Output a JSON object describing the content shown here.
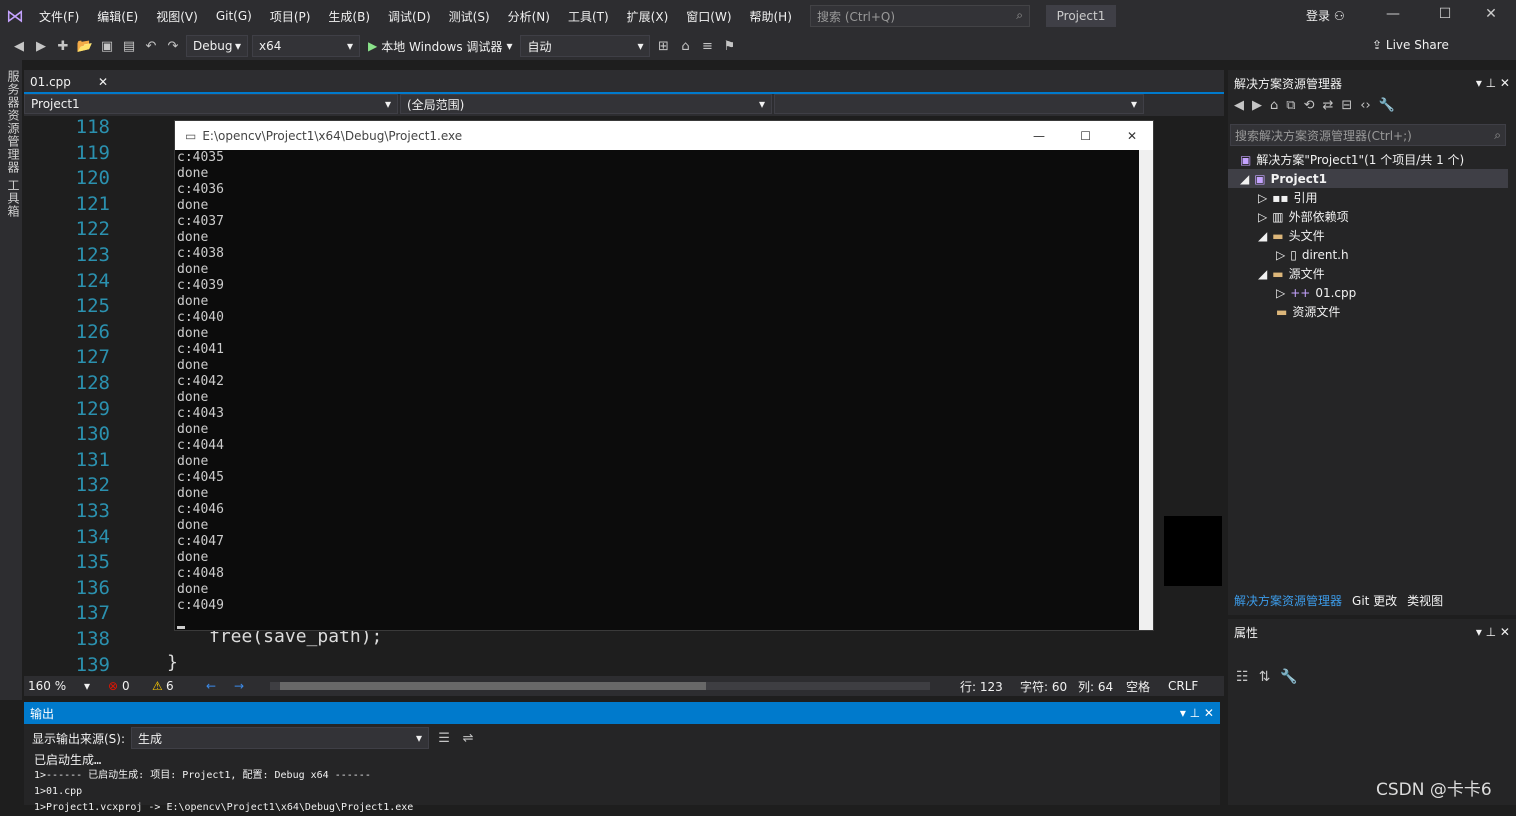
{
  "menubar": {
    "items": [
      "文件(F)",
      "编辑(E)",
      "视图(V)",
      "Git(G)",
      "项目(P)",
      "生成(B)",
      "调试(D)",
      "测试(S)",
      "分析(N)",
      "工具(T)",
      "扩展(X)",
      "窗口(W)",
      "帮助(H)"
    ],
    "search_placeholder": "搜索 (Ctrl+Q)",
    "project_title": "Project1",
    "login": "登录"
  },
  "toolbar": {
    "config": "Debug",
    "platform": "x64",
    "run_label": "本地 Windows 调试器",
    "mode": "自动",
    "live_share": "Live Share"
  },
  "sidebar_vertical": "服务器资源管理器  工具箱",
  "editor": {
    "tab": "01.cpp",
    "nav_project": "Project1",
    "nav_scope": "(全局范围)",
    "line_numbers": [
      "118",
      "119",
      "120",
      "121",
      "122",
      "123",
      "124",
      "125",
      "126",
      "127",
      "128",
      "129",
      "130",
      "131",
      "132",
      "133",
      "134",
      "135",
      "136",
      "137",
      "138",
      "139"
    ],
    "code_line": "free(save_path);",
    "code_close": "}"
  },
  "console": {
    "title": "E:\\opencv\\Project1\\x64\\Debug\\Project1.exe",
    "lines": [
      "c:4035",
      "done",
      "c:4036",
      "done",
      "c:4037",
      "done",
      "c:4038",
      "done",
      "c:4039",
      "done",
      "c:4040",
      "done",
      "c:4041",
      "done",
      "c:4042",
      "done",
      "c:4043",
      "done",
      "c:4044",
      "done",
      "c:4045",
      "done",
      "c:4046",
      "done",
      "c:4047",
      "done",
      "c:4048",
      "done",
      "c:4049"
    ]
  },
  "status": {
    "zoom": "160 %",
    "errors": "0",
    "warnings": "6",
    "row": "行: 123",
    "col_char": "字符: 60",
    "col": "列: 64",
    "mode": "空格",
    "eol": "CRLF"
  },
  "output": {
    "title": "输出",
    "source_label": "显示输出来源(S):",
    "source_value": "生成",
    "lines": [
      "已启动生成…",
      "1>------ 已启动生成: 项目: Project1, 配置: Debug x64 ------",
      "1>01.cpp",
      "1>Project1.vcxproj -> E:\\opencv\\Project1\\x64\\Debug\\Project1.exe"
    ]
  },
  "solution": {
    "title": "解决方案资源管理器",
    "search_placeholder": "搜索解决方案资源管理器(Ctrl+;)",
    "root": "解决方案\"Project1\"(1 个项目/共 1 个)",
    "project": "Project1",
    "items": [
      "引用",
      "外部依赖项",
      "头文件",
      "dirent.h",
      "源文件",
      "01.cpp",
      "资源文件"
    ],
    "tabs": [
      "解决方案资源管理器",
      "Git 更改",
      "类视图"
    ]
  },
  "properties": {
    "title": "属性"
  },
  "watermark": "CSDN @卡卡6"
}
